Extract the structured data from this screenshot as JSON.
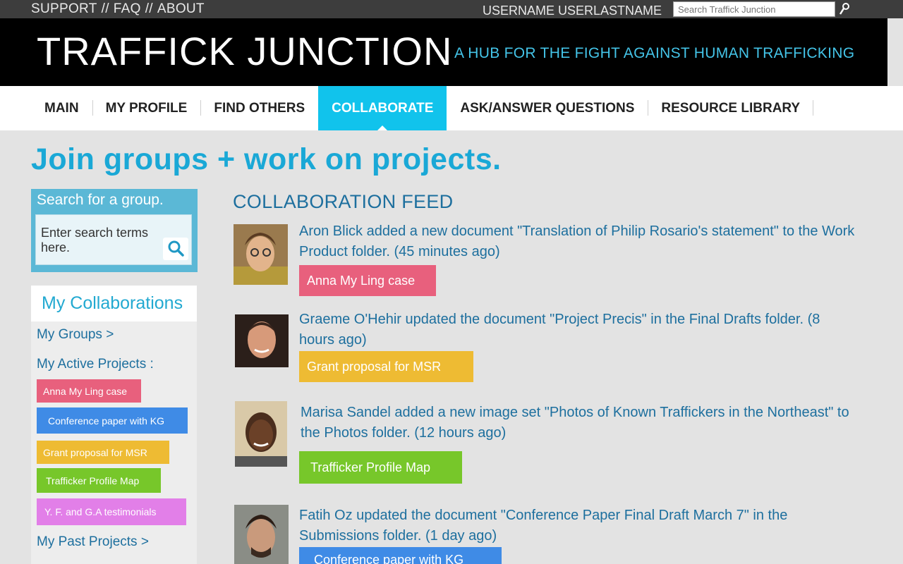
{
  "topbar": {
    "links": [
      "SUPPORT",
      "FAQ",
      "ABOUT"
    ],
    "separator": "//",
    "username": "USERNAME USERLASTNAME",
    "search_placeholder": "Search Traffick Junction"
  },
  "brand": {
    "logo": "TRAFFICK JUNCTION",
    "tagline": "A HUB FOR THE FIGHT AGAINST HUMAN TRAFFICKING"
  },
  "nav": {
    "items": [
      "MAIN",
      "MY PROFILE",
      "FIND OTHERS",
      "COLLABORATE",
      "ASK/ANSWER QUESTIONS",
      "RESOURCE LIBRARY"
    ],
    "active_index": 3
  },
  "headline": "Join groups + work on projects.",
  "group_search": {
    "title": "Search for a group.",
    "placeholder": "Enter search terms here."
  },
  "collaborations": {
    "title": "My Collaborations",
    "groups_link": "My Groups  >",
    "active_projects_label": "My Active Projects  :",
    "projects": [
      {
        "label": "Anna My Ling case",
        "color": "#e8607d"
      },
      {
        "label": "Conference paper with KG",
        "color": "#3f8be6"
      },
      {
        "label": "Grant proposal for MSR",
        "color": "#eebb33"
      },
      {
        "label": "Trafficker Profile Map",
        "color": "#77c72a"
      },
      {
        "label": "Y. F. and G.A testimonials",
        "color": "#e27fe8"
      }
    ],
    "past_link": "My Past Projects  >"
  },
  "feed": {
    "title": "COLLABORATION FEED",
    "items": [
      {
        "text": "Aron Blick added a new document \"Translation of Philip Rosario's statement\" to the Work Product folder. (45 minutes ago)",
        "tag": "Anna My Ling case",
        "tag_color": "#e8607d"
      },
      {
        "text": "Graeme O'Hehir updated the document \"Project Precis\" in the Final Drafts folder. (8 hours ago)",
        "tag": "Grant proposal for MSR",
        "tag_color": "#eebb33"
      },
      {
        "text": "Marisa Sandel added a new image set \"Photos of Known Traffickers in the Northeast\" to the Photos folder. (12 hours ago)",
        "tag": "Trafficker Profile Map",
        "tag_color": "#77c72a"
      },
      {
        "text": "Fatih Oz updated the document \"Conference Paper Final Draft March 7\" in the Submissions folder. (1 day ago)",
        "tag": "Conference paper with KG",
        "tag_color": "#3f8be6"
      }
    ]
  },
  "icons": {
    "top_search": "search-icon",
    "group_search": "magnifier-icon"
  }
}
